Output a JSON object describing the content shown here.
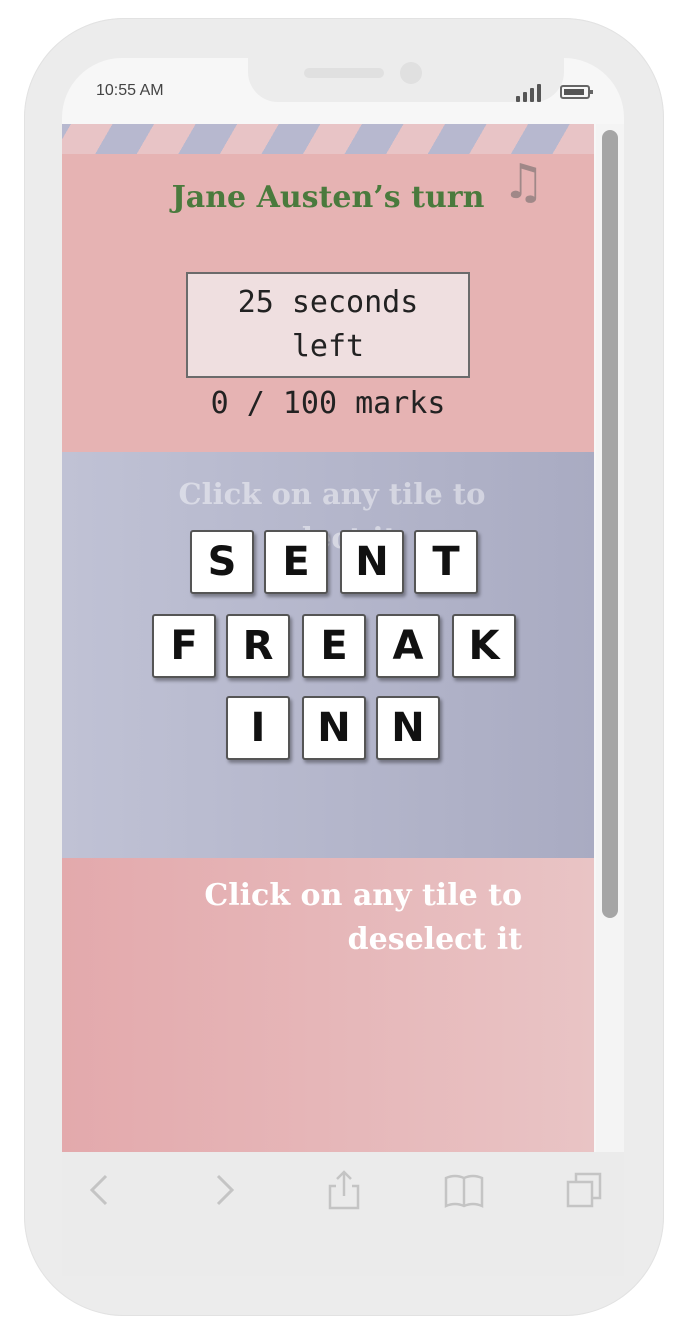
{
  "status_bar": {
    "time": "10:55 AM"
  },
  "game": {
    "turn_label": "Jane Austen’s turn",
    "timer_text": "25 seconds left",
    "score_text": "0 / 100 marks",
    "select_hint": "Click on any tile to select it",
    "deselect_hint": "Click on any tile to deselect it",
    "music_icon": "music-note-icon"
  },
  "words": [
    {
      "word": "SENT",
      "letters": [
        "S",
        "E",
        "N",
        "T"
      ]
    },
    {
      "word": "FREAK",
      "letters": [
        "F",
        "R",
        "E",
        "A",
        "K"
      ]
    },
    {
      "word": "INN",
      "letters": [
        "I",
        "N",
        "N"
      ]
    }
  ],
  "colors": {
    "header_bg": "#e6b3b3",
    "turn_text": "#4a7a3d",
    "board_bg": "#b5b7cb",
    "tray_bg": "#e6b5b7"
  },
  "toolbar": {
    "icons": [
      "back-icon",
      "forward-icon",
      "share-icon",
      "bookmarks-icon",
      "tabs-icon"
    ]
  }
}
